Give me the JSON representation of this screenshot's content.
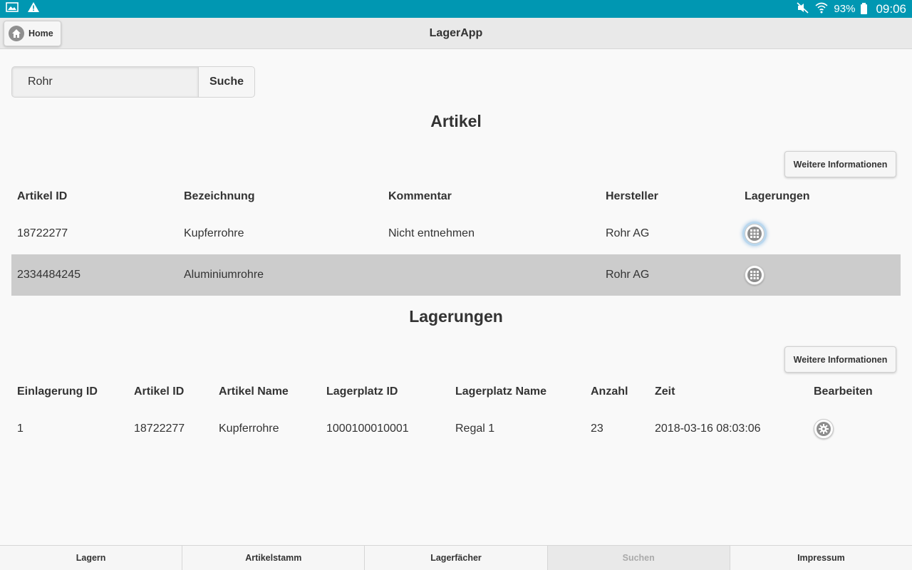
{
  "status_bar": {
    "battery": "93%",
    "time": "09:06",
    "icons": [
      "image-icon",
      "warning-icon",
      "mute-icon",
      "wifi-icon",
      "battery-icon"
    ]
  },
  "header": {
    "title": "LagerApp",
    "home_label": "Home"
  },
  "search": {
    "value": "Rohr",
    "button_label": "Suche"
  },
  "articles": {
    "title": "Artikel",
    "info_button": "Weitere Informationen",
    "columns": [
      "Artikel ID",
      "Bezeichnung",
      "Kommentar",
      "Hersteller",
      "Lagerungen"
    ],
    "rows": [
      {
        "id": "18722277",
        "name": "Kupferrohre",
        "comment": "Nicht entnehmen",
        "maker": "Rohr AG"
      },
      {
        "id": "2334484245",
        "name": "Aluminiumrohre",
        "comment": "",
        "maker": "Rohr AG"
      }
    ]
  },
  "storage": {
    "title": "Lagerungen",
    "info_button": "Weitere Informationen",
    "columns": [
      "Einlagerung ID",
      "Artikel ID",
      "Artikel Name",
      "Lagerplatz ID",
      "Lagerplatz Name",
      "Anzahl",
      "Zeit",
      "Bearbeiten"
    ],
    "rows": [
      {
        "einlagerung_id": "1",
        "artikel_id": "18722277",
        "artikel_name": "Kupferrohre",
        "lagerplatz_id": "1000100010001",
        "lagerplatz_name": "Regal 1",
        "anzahl": "23",
        "zeit": "2018-03-16 08:03:06"
      }
    ]
  },
  "bottom_nav": {
    "tabs": [
      "Lagern",
      "Artikelstamm",
      "Lagerfächer",
      "Suchen",
      "Impressum"
    ],
    "active": "Suchen"
  }
}
